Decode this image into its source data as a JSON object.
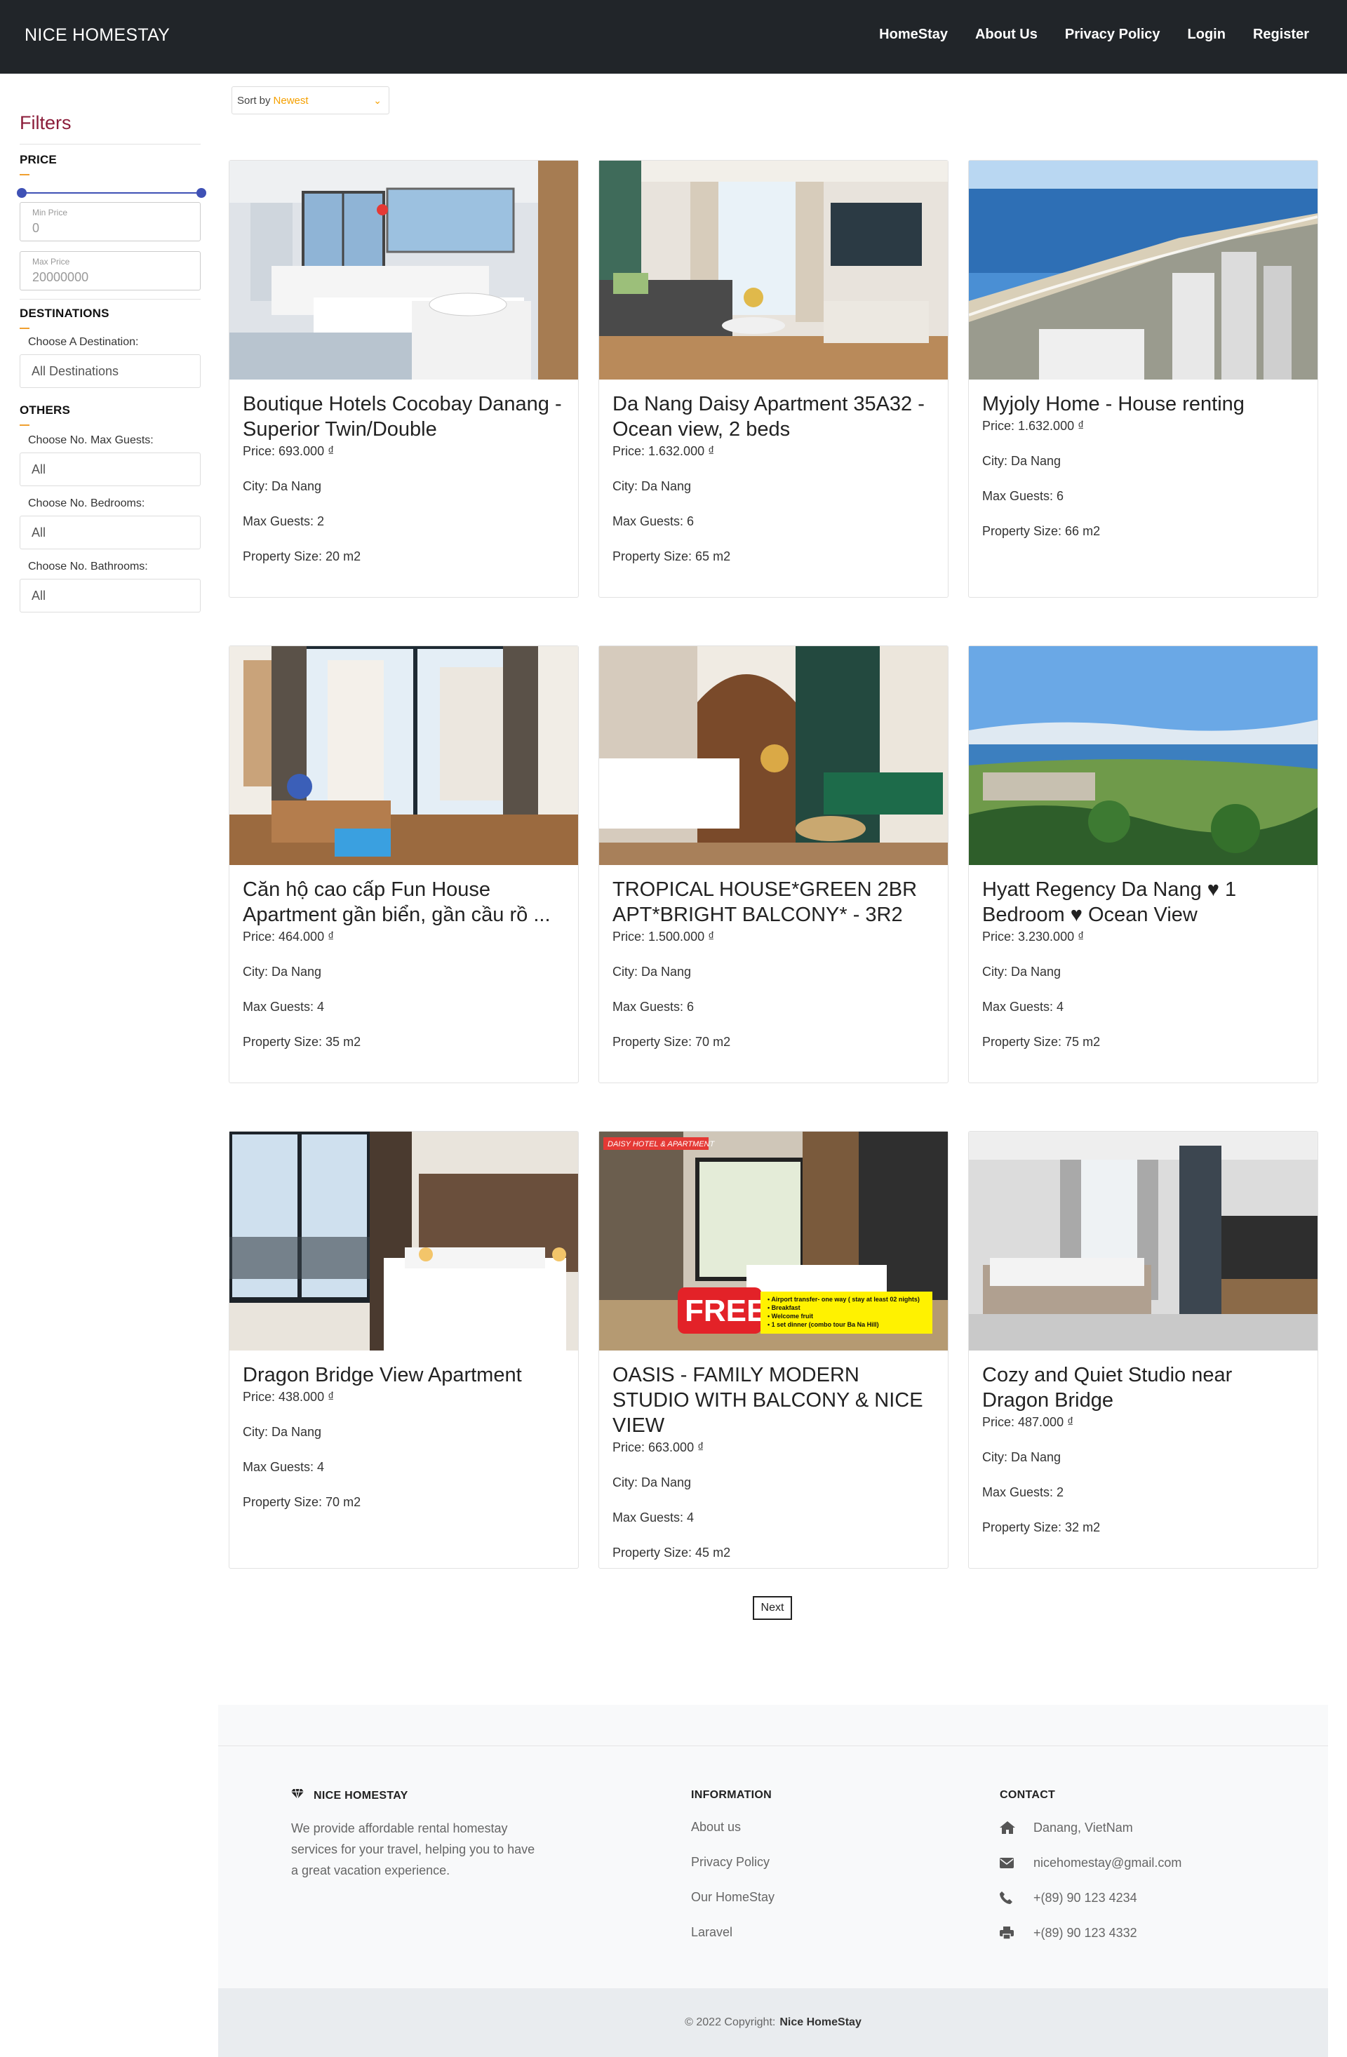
{
  "nav": {
    "brand": "NICE HOMESTAY",
    "links": [
      "HomeStay",
      "About Us",
      "Privacy Policy",
      "Login",
      "Register"
    ]
  },
  "sidebar": {
    "title": "Filters",
    "price": {
      "heading": "PRICE",
      "min_label": "Min Price",
      "min_value": "0",
      "max_label": "Max Price",
      "max_value": "20000000"
    },
    "destinations": {
      "heading": "DESTINATIONS",
      "label": "Choose A Destination:",
      "value": "All Destinations"
    },
    "others": {
      "heading": "OTHERS",
      "guests_label": "Choose No. Max Guests:",
      "guests_value": "All",
      "bedrooms_label": "Choose No. Bedrooms:",
      "bedrooms_value": "All",
      "bathrooms_label": "Choose No. Bathrooms:",
      "bathrooms_value": "All"
    }
  },
  "sort": {
    "label": "Sort by",
    "value": "Newest"
  },
  "listings": [
    {
      "title": "Boutique Hotels Cocobay Danang - Superior Twin/Double",
      "price": "Price: 693.000 ₫",
      "city": "City: Da Nang",
      "guests": "Max Guests: 2",
      "size": "Property Size: 20 m2",
      "photo": "bedroom-twin"
    },
    {
      "title": "Da Nang Daisy Apartment 35A32 - Ocean view, 2 beds",
      "price": "Price: 1.632.000 ₫",
      "city": "City: Da Nang",
      "guests": "Max Guests: 6",
      "size": "Property Size: 65 m2",
      "photo": "living-room"
    },
    {
      "title": "Myjoly Home - House renting",
      "price": "Price: 1.632.000 ₫",
      "city": "City: Da Nang",
      "guests": "Max Guests: 6",
      "size": "Property Size: 66 m2",
      "photo": "coast-aerial"
    },
    {
      "title": "Căn hộ cao cấp Fun House Apartment gần biển, gần cầu rồ ...",
      "price": "Price: 464.000 ₫",
      "city": "City: Da Nang",
      "guests": "Max Guests: 4",
      "size": "Property Size: 35 m2",
      "photo": "bedroom-window"
    },
    {
      "title": "TROPICAL HOUSE*GREEN 2BR APT*BRIGHT BALCONY* - 3R2",
      "price": "Price: 1.500.000 ₫",
      "city": "City: Da Nang",
      "guests": "Max Guests: 6",
      "size": "Property Size: 70 m2",
      "photo": "green-room"
    },
    {
      "title": "Hyatt Regency Da Nang ♥ 1 Bedroom ♥ Ocean View",
      "price": "Price: 3.230.000 ₫",
      "city": "City: Da Nang",
      "guests": "Max Guests: 4",
      "size": "Property Size: 75 m2",
      "photo": "resort-view"
    },
    {
      "title": "Dragon Bridge View Apartment",
      "price": "Price: 438.000 ₫",
      "city": "City: Da Nang",
      "guests": "Max Guests: 4",
      "size": "Property Size: 70 m2",
      "photo": "bedroom-brown"
    },
    {
      "title": "OASIS - FAMILY MODERN STUDIO WITH BALCONY & NICE VIEW",
      "price": "Price: 663.000 ₫",
      "city": "City: Da Nang",
      "guests": "Max Guests: 4",
      "size": "Property Size: 45 m2",
      "photo": "studio-promo"
    },
    {
      "title": "Cozy and Quiet Studio near Dragon Bridge",
      "price": "Price: 487.000 ₫",
      "city": "City: Da Nang",
      "guests": "Max Guests: 2",
      "size": "Property Size: 32 m2",
      "photo": "studio-grey"
    }
  ],
  "promo": {
    "tag": "DAISY HOTEL & APARTMENT",
    "free": "FREE",
    "lines": [
      "Airport transfer- one way ( stay at least 02 nights)",
      "Breakfast",
      "Welcome fruit",
      "1 set dinner (combo tour Ba Na Hill)"
    ]
  },
  "pagination": {
    "next": "Next"
  },
  "footer": {
    "brand": "NICE HOMESTAY",
    "about": "We provide affordable rental homestay services for your travel, helping you to have a great vacation experience.",
    "info_heading": "INFORMATION",
    "info_links": [
      "About us",
      "Privacy Policy",
      "Our HomeStay",
      "Laravel"
    ],
    "contact_heading": "CONTACT",
    "address": "Danang, VietNam",
    "email": "nicehomestay@gmail.com",
    "phone": "+(89) 90 123 4234",
    "fax": "+(89) 90 123 4332",
    "copyright_prefix": "© 2022 Copyright:",
    "copyright_name": "Nice HomeStay"
  },
  "colors": {
    "navbar": "#212529",
    "filters_title": "#8b1d3a",
    "accent_orange": "#f5a000",
    "slider": "#3f51b5"
  }
}
